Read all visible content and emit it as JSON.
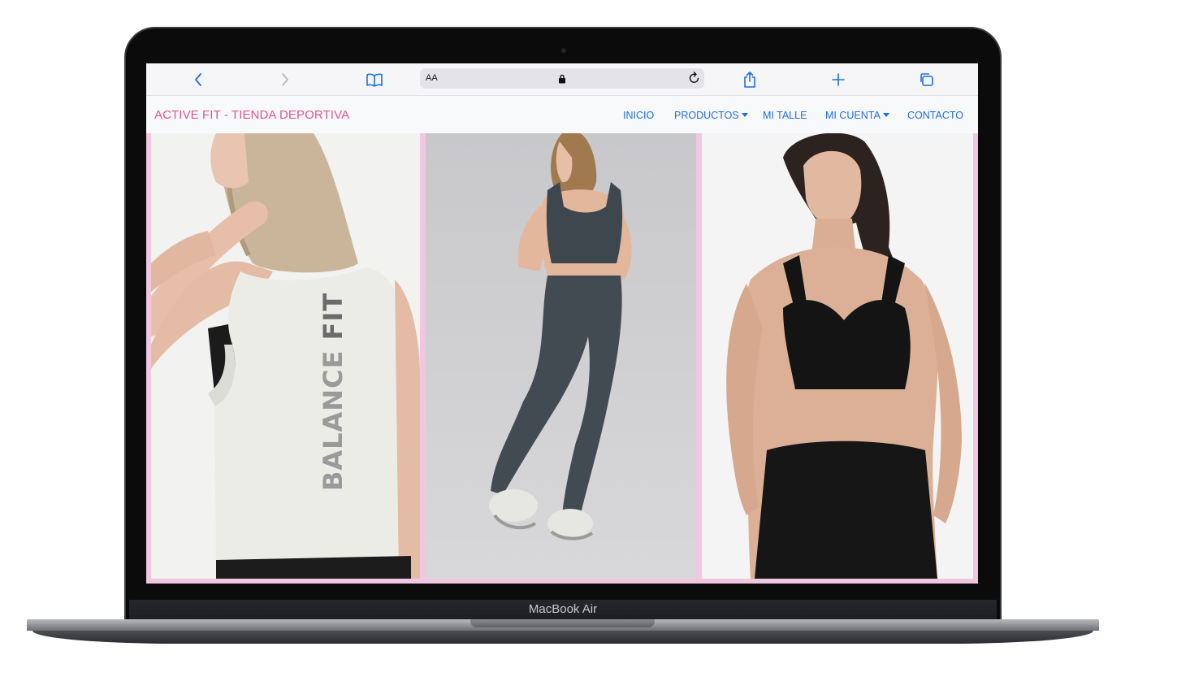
{
  "browser": {
    "address_text_size_label": "AA"
  },
  "navbar": {
    "brand": "ACTIVE FIT - TIENDA DEPORTIVA",
    "items": [
      {
        "label": "INICIO",
        "dropdown": false
      },
      {
        "label": "PRODUCTOS",
        "dropdown": true
      },
      {
        "label": "MI TALLE",
        "dropdown": false
      },
      {
        "label": "MI CUENTA",
        "dropdown": true
      },
      {
        "label": "CONTACTO",
        "dropdown": false
      }
    ]
  },
  "gallery": {
    "shirt_print_1": "BALANCE",
    "shirt_print_2": "FIT"
  },
  "device": {
    "label": "MacBook Air"
  },
  "colors": {
    "brand": "#e0568f",
    "nav_link": "#1f6fe0",
    "accent_border": "#efc7df",
    "navbar_bg": "#f8f9fb"
  },
  "icons": [
    "back-icon",
    "forward-icon",
    "bookmarks-icon",
    "lock-icon",
    "reload-icon",
    "share-icon",
    "new-tab-icon",
    "tabs-icon"
  ]
}
